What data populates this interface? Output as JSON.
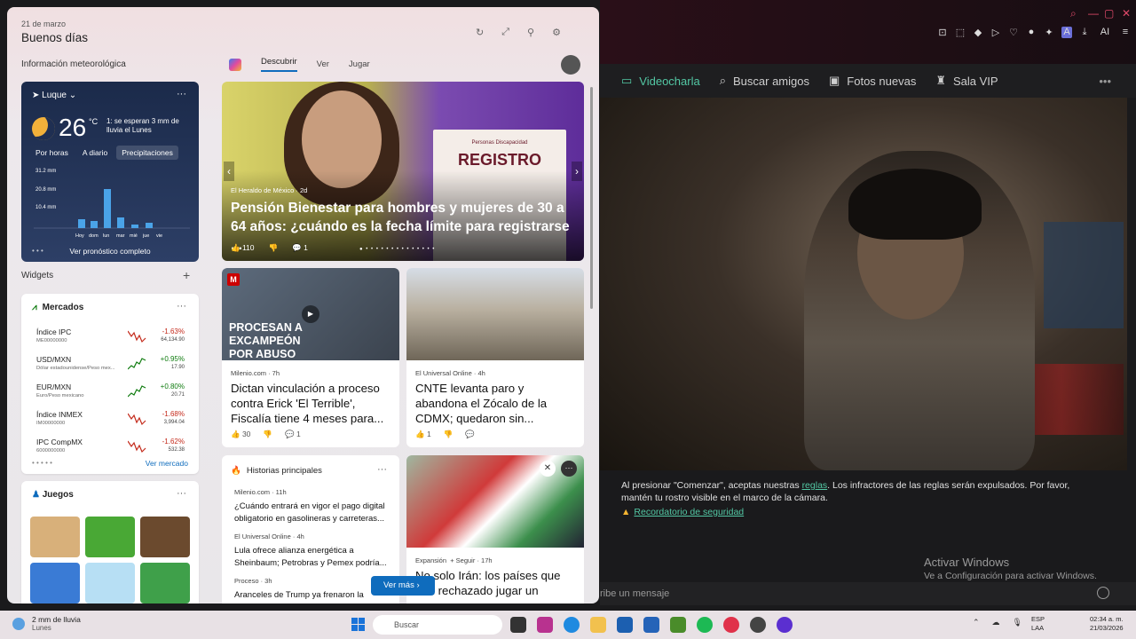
{
  "browser": {
    "chat_nav": [
      {
        "label": "Videocharla",
        "icon": "video-icon",
        "active": true
      },
      {
        "label": "Buscar amigos",
        "icon": "search-icon",
        "active": false
      },
      {
        "label": "Fotos nuevas",
        "icon": "photo-icon",
        "active": false
      },
      {
        "label": "Sala VIP",
        "icon": "trophy-icon",
        "active": false
      }
    ],
    "notice_pre": "Al presionar \"Comenzar\", aceptas nuestras ",
    "notice_link": "reglas",
    "notice_post": ". Los infractores de las reglas serán expulsados. Por favor, mantén tu rostro visible en el marco de la cámara.",
    "safety_link": "Recordatorio de seguridad",
    "message_placeholder": "ribe un mensaje",
    "activate_title": "Activar Windows",
    "activate_sub": "Ve a Configuración para activar Windows.",
    "toolbar_ai": "AI"
  },
  "widgets": {
    "date": "21 de marzo",
    "greeting": "Buenos días",
    "weather_section": "Información meteorológica",
    "weather": {
      "location": "Luque",
      "temp": "26",
      "unit": "°C",
      "forecast": "1: se esperan 3 mm de lluvia el Lunes",
      "tabs": [
        "Por horas",
        "A diario",
        "Precipitaciones"
      ],
      "y_labels": [
        "31.2 mm",
        "20.8 mm",
        "10.4 mm"
      ],
      "days": [
        "Hoy",
        "dom",
        "lun",
        "mar",
        "mié",
        "jue",
        "vie"
      ],
      "more": "Ver pronóstico completo"
    },
    "widgets_section": "Widgets",
    "markets": {
      "title": "Mercados",
      "rows": [
        {
          "name": "Índice IPC",
          "sub": "ME00000000",
          "change": "-1.63%",
          "price": "64,134.90",
          "dir": "neg"
        },
        {
          "name": "USD/MXN",
          "sub": "Dólar estadounidense/Peso mex...",
          "change": "+0.95%",
          "price": "17.90",
          "dir": "pos"
        },
        {
          "name": "EUR/MXN",
          "sub": "Euro/Peso mexicano",
          "change": "+0.80%",
          "price": "20.71",
          "dir": "pos"
        },
        {
          "name": "Índice INMEX",
          "sub": "IM00000000",
          "change": "-1.68%",
          "price": "3,994.04",
          "dir": "neg"
        },
        {
          "name": "IPC CompMX",
          "sub": "6000000000",
          "change": "-1.62%",
          "price": "532.38",
          "dir": "neg"
        }
      ],
      "more": "Ver mercado"
    },
    "games": {
      "title": "Juegos"
    }
  },
  "feed": {
    "tabs": [
      "Descubrir",
      "Ver",
      "Jugar"
    ],
    "hero": {
      "source": "El Heraldo de México · 2d",
      "title": "Pensión Bienestar para hombres y mujeres de 30 a 64 años: ¿cuándo es la fecha límite para registrarse ...",
      "likes": "110",
      "comments": "1",
      "poster_top": "Personas Discapacidad",
      "poster_title": "REGISTRO"
    },
    "news1": {
      "overlay": "PROCESAN A EXCAMPEÓN POR ABUSO",
      "source": "Milenio.com · 7h",
      "title": "Dictan vinculación a proceso contra Erick 'El Terrible', Fiscalía tiene 4 meses para...",
      "likes": "30",
      "comments": "1"
    },
    "news2": {
      "source": "El Universal Online · 4h",
      "title": "CNTE levanta paro y abandona el Zócalo de la CDMX; quedaron sin...",
      "likes": "1"
    },
    "top_stories": {
      "title": "Historias principales",
      "items": [
        {
          "source": "Milenio.com · 11h",
          "title": "¿Cuándo entrará en vigor el pago digital obligatorio en gasolineras y carreteras..."
        },
        {
          "source": "El Universal Online · 4h",
          "title": "Lula ofrece alianza energética a Sheinbaum; Petrobras y Pemex podría..."
        },
        {
          "source": "Proceso · 3h",
          "title": "Aranceles de Trump ya frenaron la"
        }
      ]
    },
    "news3": {
      "source": "Expansión",
      "follow": "+ Seguir",
      "time": "· 17h",
      "title": "No solo Irán: los países que han rechazado jugar un"
    },
    "see_more": "Ver más"
  },
  "taskbar": {
    "weather_title": "2 mm de lluvia",
    "weather_sub": "Lunes",
    "search": "Buscar",
    "lang1": "ESP",
    "lang2": "LAA",
    "time": "02:34 a. m.",
    "date": "21/03/2026"
  }
}
